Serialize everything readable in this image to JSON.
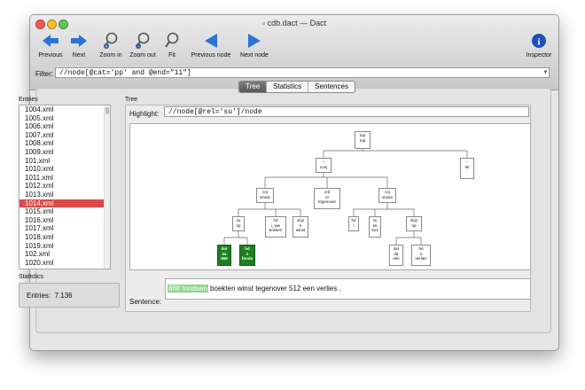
{
  "window": {
    "title": "cdb.dact — Dact"
  },
  "toolbar": {
    "previous": "Previous",
    "next": "Next",
    "zoom_in": "Zoom in",
    "zoom_out": "Zoom out",
    "fit": "Fit",
    "previous_node": "Previous node",
    "next_node": "Next node",
    "inspector": "Inspector"
  },
  "filter": {
    "label": "Filter:",
    "value": "//node[@cat='pp' and @end=\"11\"]"
  },
  "tabs": {
    "tree": "Tree",
    "statistics": "Statistics",
    "sentences": "Sentences"
  },
  "entries": {
    "label": "Entries",
    "items": [
      "1004.xml",
      "1005.xml",
      "1006.xml",
      "1007.xml",
      "1008.xml",
      "1009.xml",
      "101.xml",
      "1010.xml",
      "1011.xml",
      "1012.xml",
      "1013.xml",
      "1014.xml",
      "1015.xml",
      "1016.xml",
      "1017.xml",
      "1018.xml",
      "1019.xml",
      "102.xml",
      "1020.xml"
    ],
    "selected": "1014.xml"
  },
  "statistics": {
    "label": "Statistics",
    "entries_label": "Entries:",
    "entries_value": "7.136"
  },
  "tree": {
    "label": "Tree",
    "highlight_label": "Highlight:",
    "highlight_value": "//node[@rel='su']/node",
    "nodes": {
      "top": [
        "top",
        "top"
      ],
      "conj": [
        "--",
        "conj"
      ],
      "let": [
        "--",
        "let",
        "."
      ],
      "cnj1": [
        "cnj",
        "smain"
      ],
      "crd": [
        "crd",
        "vz",
        "tegenover"
      ],
      "cnj2": [
        "cnj",
        "smain"
      ],
      "su1": [
        "su",
        "np"
      ],
      "hd1": [
        "hd",
        "i_ww",
        "boeken"
      ],
      "obj1": [
        "obj1",
        "n",
        "winst"
      ],
      "hd2": [
        "hd",
        "i"
      ],
      "su2": [
        "su",
        "tw",
        "512"
      ],
      "obj2": [
        "obj1",
        "np"
      ],
      "det1": [
        "det",
        "tw",
        "868"
      ],
      "hdn": [
        "hd",
        "n",
        "fonds"
      ],
      "det2": [
        "det",
        "lid",
        "een"
      ],
      "hd3": [
        "hd",
        "n",
        "verlies"
      ]
    }
  },
  "sentence": {
    "label": "Sentence:",
    "hl1": "868",
    "hl2": "fondsen",
    "rest": " boekten winst tegenover 512 een verlies ."
  }
}
